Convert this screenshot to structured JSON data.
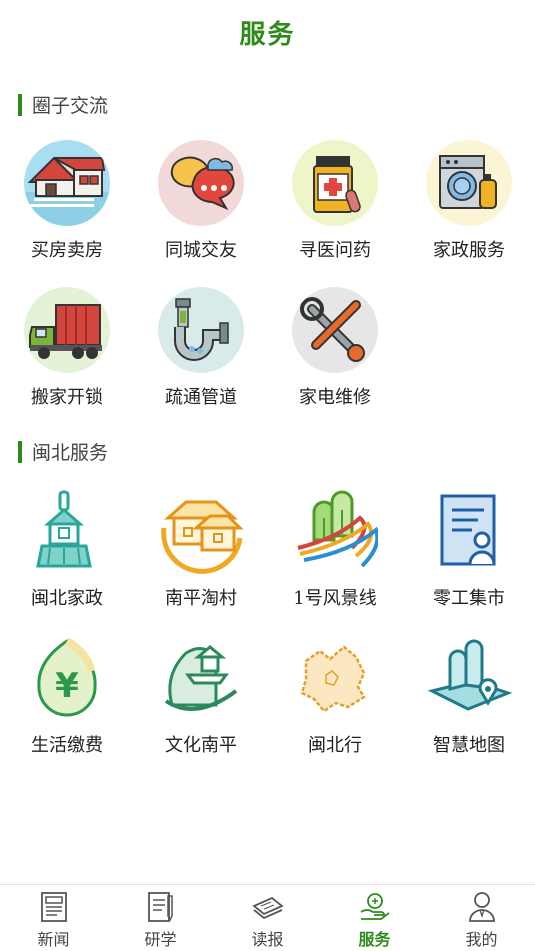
{
  "header": {
    "title": "服务"
  },
  "sections": [
    {
      "title": "圈子交流",
      "items": [
        {
          "label": "买房卖房",
          "icon": "house-icon"
        },
        {
          "label": "同城交友",
          "icon": "chat-bubbles-icon"
        },
        {
          "label": "寻医问药",
          "icon": "medicine-bottle-icon"
        },
        {
          "label": "家政服务",
          "icon": "washing-machine-icon"
        },
        {
          "label": "搬家开锁",
          "icon": "moving-truck-icon"
        },
        {
          "label": "疏通管道",
          "icon": "pipe-icon"
        },
        {
          "label": "家电维修",
          "icon": "repair-tools-icon"
        }
      ]
    },
    {
      "title": "闽北服务",
      "items": [
        {
          "label": "闽北家政",
          "icon": "cleaning-brush-icon"
        },
        {
          "label": "南平淘村",
          "icon": "village-houses-icon"
        },
        {
          "label": "1号风景线",
          "icon": "scenic-road-icon"
        },
        {
          "label": "零工集市",
          "icon": "resume-document-icon"
        },
        {
          "label": "生活缴费",
          "icon": "yuan-leaf-icon"
        },
        {
          "label": "文化南平",
          "icon": "culture-pavilion-icon"
        },
        {
          "label": "闽北行",
          "icon": "region-map-icon"
        },
        {
          "label": "智慧地图",
          "icon": "smart-map-icon"
        }
      ]
    }
  ],
  "tabbar": {
    "tabs": [
      {
        "label": "新闻",
        "icon": "newspaper-icon",
        "active": false
      },
      {
        "label": "研学",
        "icon": "notebook-pen-icon",
        "active": false
      },
      {
        "label": "读报",
        "icon": "newspaper-stack-icon",
        "active": false
      },
      {
        "label": "服务",
        "icon": "service-hand-icon",
        "active": true
      },
      {
        "label": "我的",
        "icon": "user-profile-icon",
        "active": false
      }
    ]
  },
  "colors": {
    "accent": "#2e8b1a",
    "active_tab": "#2e8b1a",
    "text": "#222222"
  }
}
